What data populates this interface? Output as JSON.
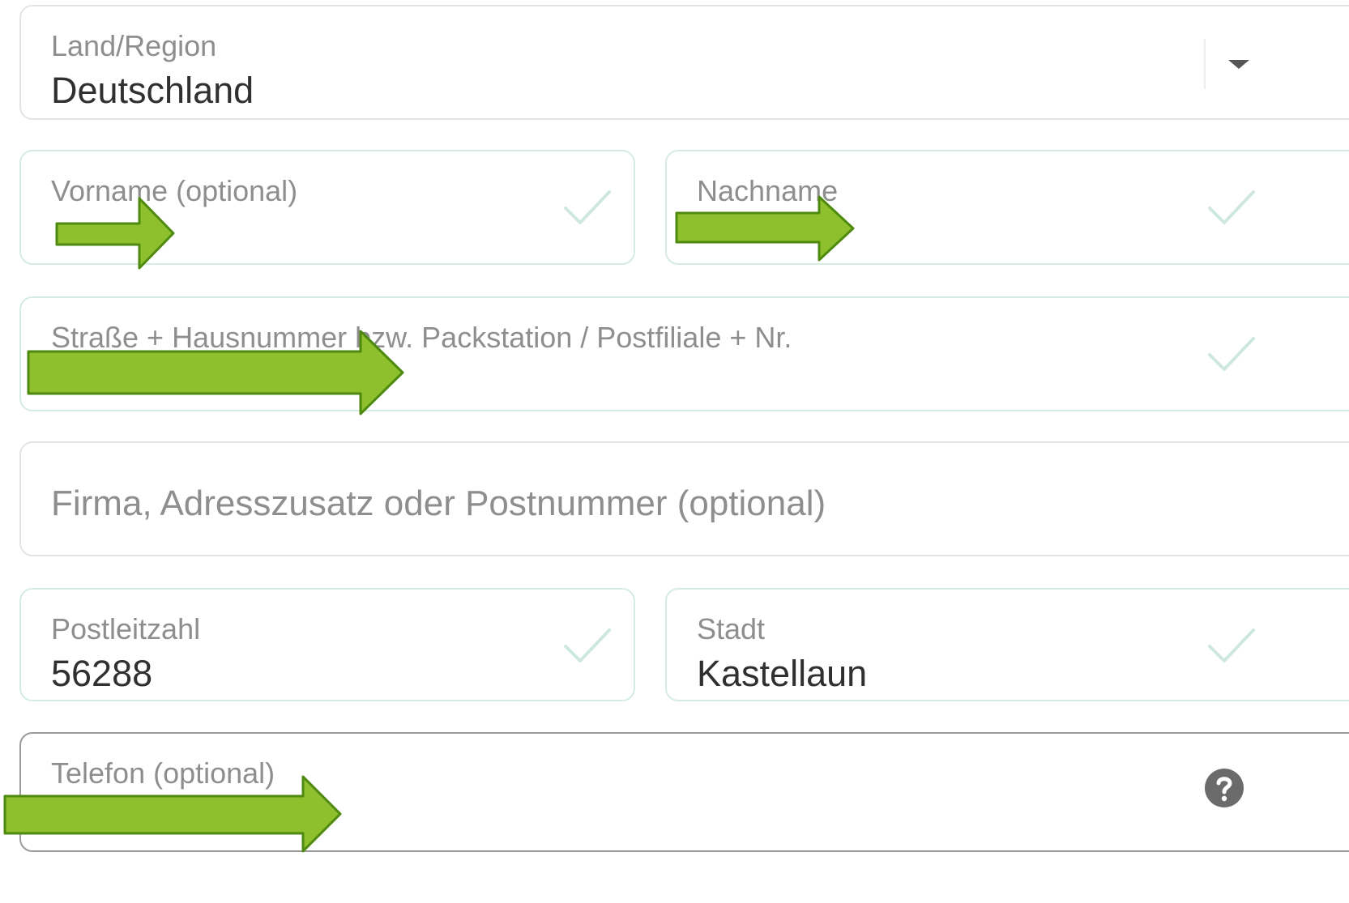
{
  "form": {
    "country": {
      "label": "Land/Region",
      "value": "Deutschland"
    },
    "first_name": {
      "label": "Vorname (optional)",
      "value": ""
    },
    "last_name": {
      "label": "Nachname",
      "value": ""
    },
    "street": {
      "label": "Straße + Hausnummer bzw. Packstation / Postfiliale + Nr.",
      "value": ""
    },
    "company": {
      "placeholder": "Firma, Adresszusatz oder Postnummer (optional)"
    },
    "postal_code": {
      "label": "Postleitzahl",
      "value": "56288"
    },
    "city": {
      "label": "Stadt",
      "value": "Kastellaun"
    },
    "phone": {
      "label": "Telefon (optional)",
      "value": ""
    }
  },
  "colors": {
    "valid_border": "#d6ebe2",
    "check": "#cfe8dd",
    "annotation_arrow": "#8dc02c",
    "annotation_arrow_outline": "#4f8a10",
    "help_icon": "#6b6b6b"
  },
  "icons": {
    "select": "chevron-down-icon",
    "valid": "checkmark-icon",
    "help": "help-circle-icon",
    "annotation": "arrow-right-icon"
  }
}
